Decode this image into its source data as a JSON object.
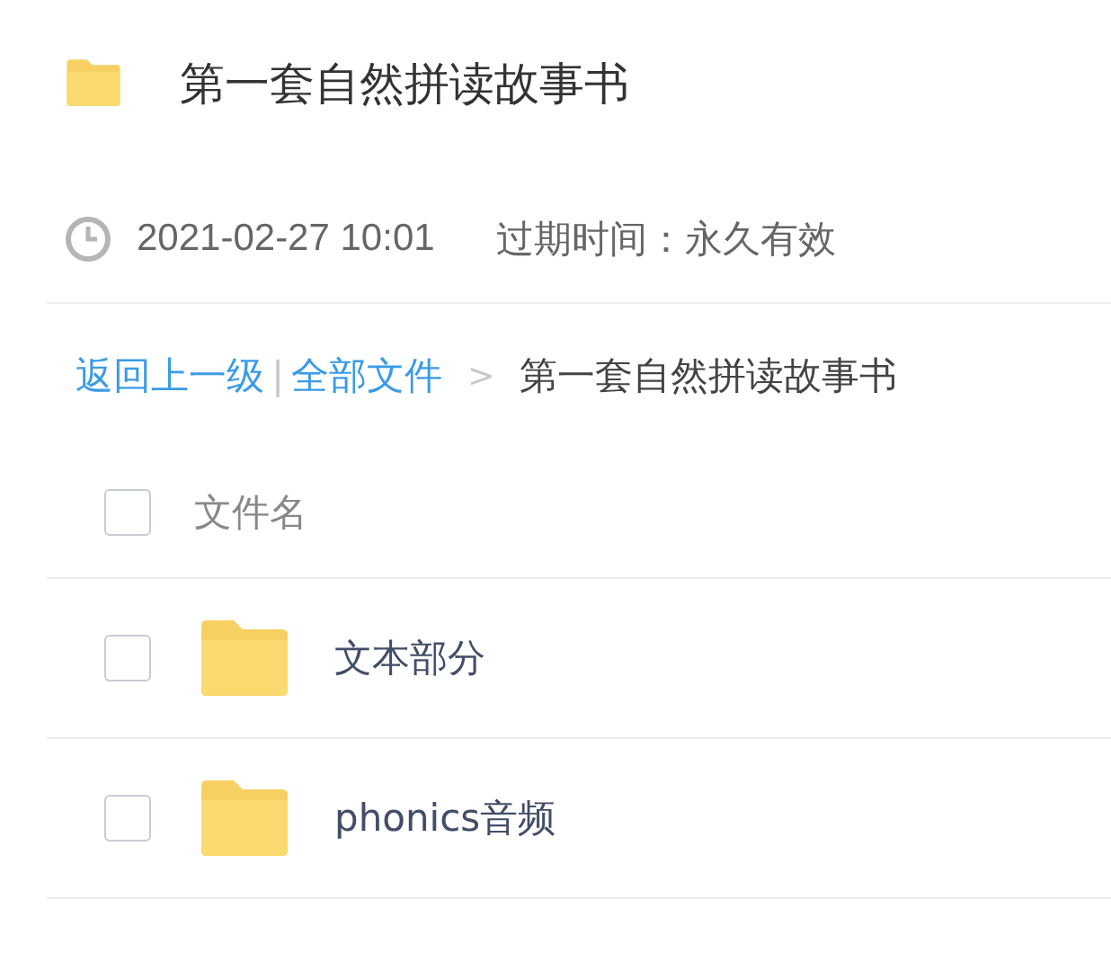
{
  "header": {
    "title": "第一套自然拼读故事书"
  },
  "meta": {
    "date": "2021-02-27 10:01",
    "expiry": "过期时间：永久有效"
  },
  "breadcrumb": [
    {
      "kind": "link",
      "text": "返回上一级"
    },
    {
      "kind": "bar",
      "text": "|"
    },
    {
      "kind": "link",
      "text": "全部文件"
    },
    {
      "kind": "arrow",
      "text": ">"
    },
    {
      "kind": "current",
      "text": "第一套自然拼读故事书"
    }
  ],
  "table": {
    "header": {
      "label": "文件名",
      "checked": false
    },
    "rows": [
      {
        "name": "文本部分",
        "checked": false
      },
      {
        "name": "phonics音频",
        "checked": false
      }
    ]
  }
}
